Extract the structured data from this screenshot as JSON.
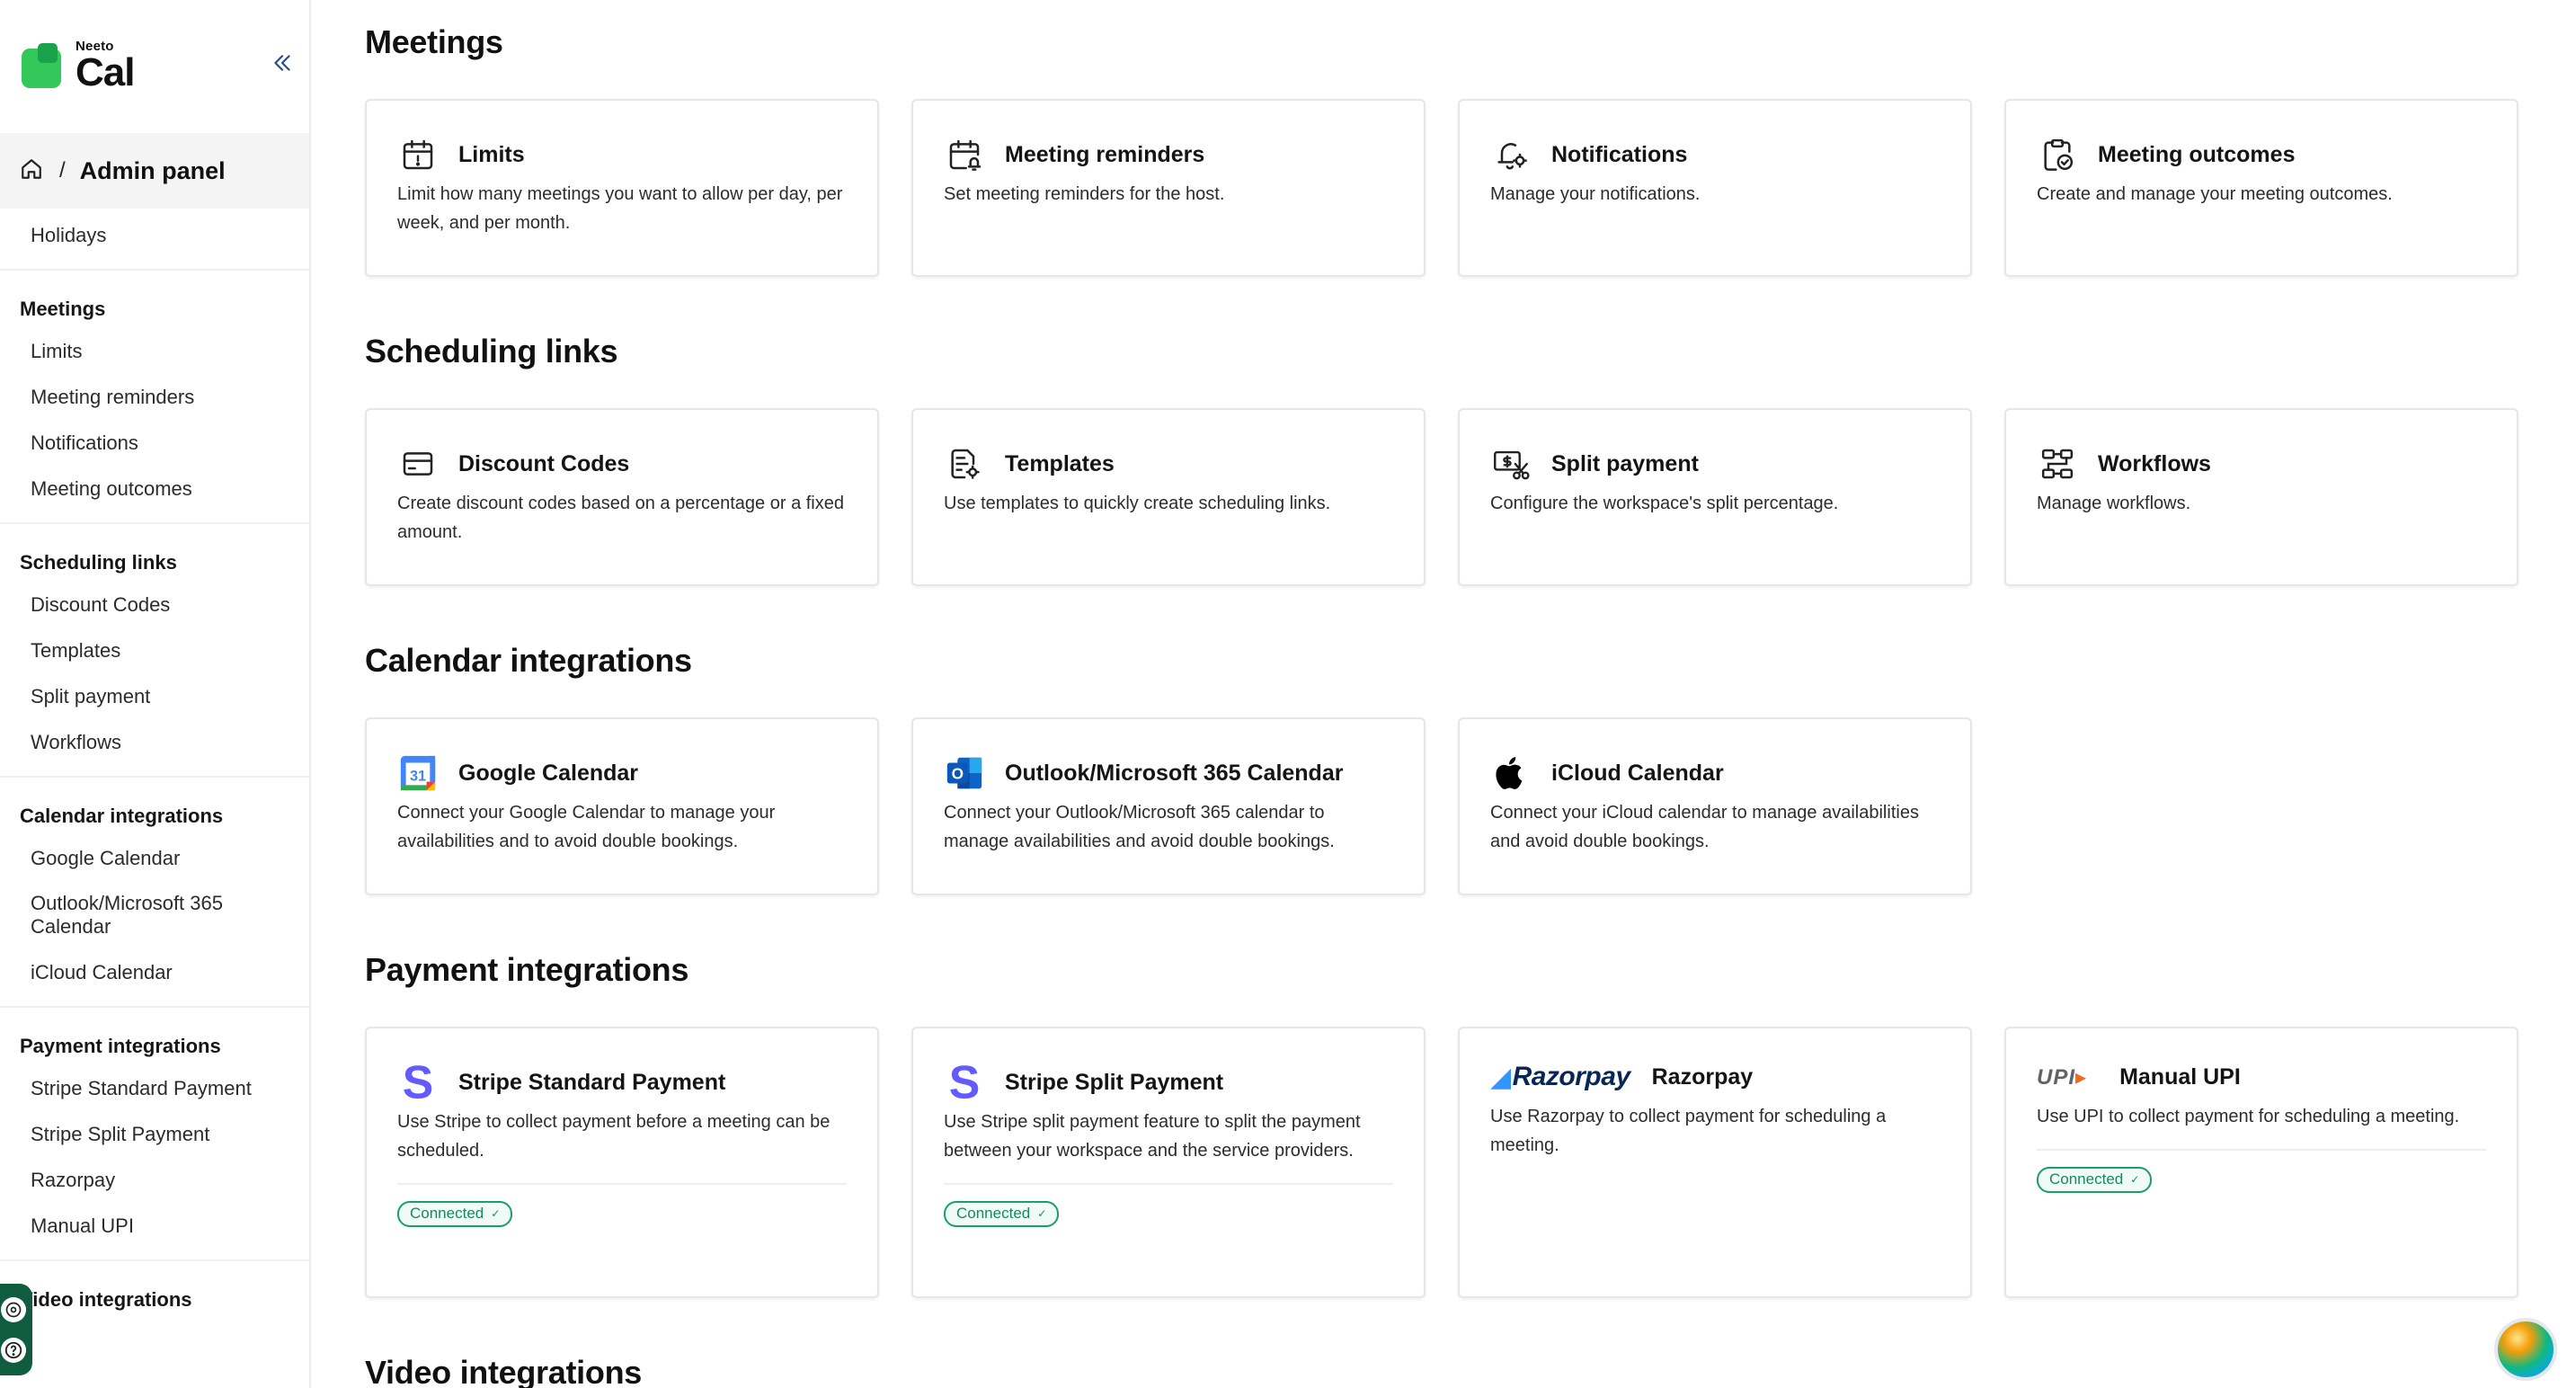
{
  "logo": {
    "small": "Neeto",
    "big": "Cal"
  },
  "breadcrumb": {
    "separator": "/",
    "label": "Admin panel"
  },
  "sidebar": {
    "top_item": "Holidays",
    "groups": [
      {
        "heading": "Meetings",
        "items": [
          "Limits",
          "Meeting reminders",
          "Notifications",
          "Meeting outcomes"
        ]
      },
      {
        "heading": "Scheduling links",
        "items": [
          "Discount Codes",
          "Templates",
          "Split payment",
          "Workflows"
        ]
      },
      {
        "heading": "Calendar integrations",
        "items": [
          "Google Calendar",
          "Outlook/Microsoft 365 Calendar",
          "iCloud Calendar"
        ]
      },
      {
        "heading": "Payment integrations",
        "items": [
          "Stripe Standard Payment",
          "Stripe Split Payment",
          "Razorpay",
          "Manual UPI"
        ]
      },
      {
        "heading": "Video integrations",
        "items": []
      }
    ]
  },
  "sections": {
    "meetings": {
      "title": "Meetings",
      "cards": [
        {
          "title": "Limits",
          "desc": "Limit how many meetings you want to allow per day, per week, and per month.",
          "icon": "calendar-limit-icon"
        },
        {
          "title": "Meeting reminders",
          "desc": "Set meeting reminders for the host.",
          "icon": "calendar-bell-icon"
        },
        {
          "title": "Notifications",
          "desc": "Manage your notifications.",
          "icon": "bell-gear-icon"
        },
        {
          "title": "Meeting outcomes",
          "desc": "Create and manage your meeting outcomes.",
          "icon": "clipboard-check-icon"
        }
      ]
    },
    "scheduling": {
      "title": "Scheduling links",
      "cards": [
        {
          "title": "Discount Codes",
          "desc": "Create discount codes based on a percentage or a fixed amount.",
          "icon": "card-icon"
        },
        {
          "title": "Templates",
          "desc": "Use templates to quickly create scheduling links.",
          "icon": "document-gear-icon"
        },
        {
          "title": "Split payment",
          "desc": "Configure the workspace's split percentage.",
          "icon": "payment-split-icon"
        },
        {
          "title": "Workflows",
          "desc": "Manage workflows.",
          "icon": "workflow-icon"
        }
      ]
    },
    "calendar": {
      "title": "Calendar integrations",
      "cards": [
        {
          "title": "Google Calendar",
          "desc": "Connect your Google Calendar to manage your availabilities and to avoid double bookings.",
          "icon": "google-calendar-icon",
          "icon_text": "31"
        },
        {
          "title": "Outlook/Microsoft 365 Calendar",
          "desc": "Connect your Outlook/Microsoft 365 calendar to manage availabilities and avoid double bookings.",
          "icon": "outlook-icon",
          "icon_text": "O"
        },
        {
          "title": "iCloud Calendar",
          "desc": "Connect your iCloud calendar to manage availabilities and avoid double bookings.",
          "icon": "apple-icon"
        }
      ]
    },
    "payment": {
      "title": "Payment integrations",
      "cards": [
        {
          "title": "Stripe Standard Payment",
          "desc": "Use Stripe to collect payment before a meeting can be scheduled.",
          "icon": "stripe-icon",
          "icon_text": "S",
          "badge": "Connected"
        },
        {
          "title": "Stripe Split Payment",
          "desc": "Use Stripe split payment feature to split the payment between your workspace and the service providers.",
          "icon": "stripe-icon",
          "icon_text": "S",
          "badge": "Connected"
        },
        {
          "title": "Razorpay",
          "desc": "Use Razorpay to collect payment for scheduling a meeting.",
          "icon": "razorpay-logo-icon",
          "logo_text": "Razorpay"
        },
        {
          "title": "Manual UPI",
          "desc": "Use UPI to collect payment for scheduling a meeting.",
          "icon": "upi-logo-icon",
          "logo_text": "UPI",
          "badge": "Connected"
        }
      ]
    },
    "video": {
      "title": "Video integrations"
    }
  },
  "badge_check": "✓",
  "colors": {
    "brand_green": "#34c759",
    "connected_green": "#1a9e6c",
    "stripe_purple": "#635bff"
  }
}
